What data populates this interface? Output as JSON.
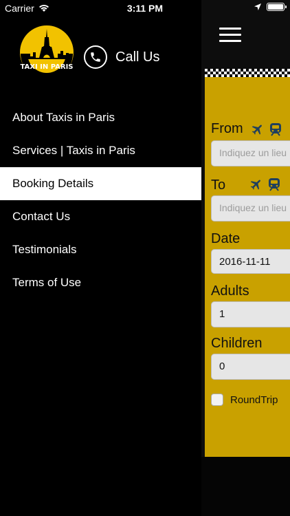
{
  "status_bar": {
    "carrier": "Carrier",
    "time": "3:11 PM",
    "battery_level": 1.0
  },
  "drawer": {
    "logo_text": "TAXI IN PARIS",
    "call_label": "Call Us",
    "menu": [
      {
        "label": "About Taxis in Paris",
        "active": false
      },
      {
        "label": "Services | Taxis in Paris",
        "active": false
      },
      {
        "label": "Booking Details",
        "active": true
      },
      {
        "label": "Contact Us",
        "active": false
      },
      {
        "label": "Testimonials",
        "active": false
      },
      {
        "label": "Terms of Use",
        "active": false
      }
    ]
  },
  "booking": {
    "from_label": "From",
    "from_placeholder": "Indiquez un lieu",
    "to_label": "To",
    "to_placeholder": "Indiquez un lieu",
    "date_label": "Date",
    "date_value": "2016-11-11",
    "adults_label": "Adults",
    "adults_value": "1",
    "children_label": "Children",
    "children_value": "0",
    "roundtrip_label": "RoundTrip",
    "roundtrip_checked": false
  },
  "colors": {
    "accent": "#c9a100",
    "logo_yellow": "#f2c200",
    "background": "#000000"
  }
}
